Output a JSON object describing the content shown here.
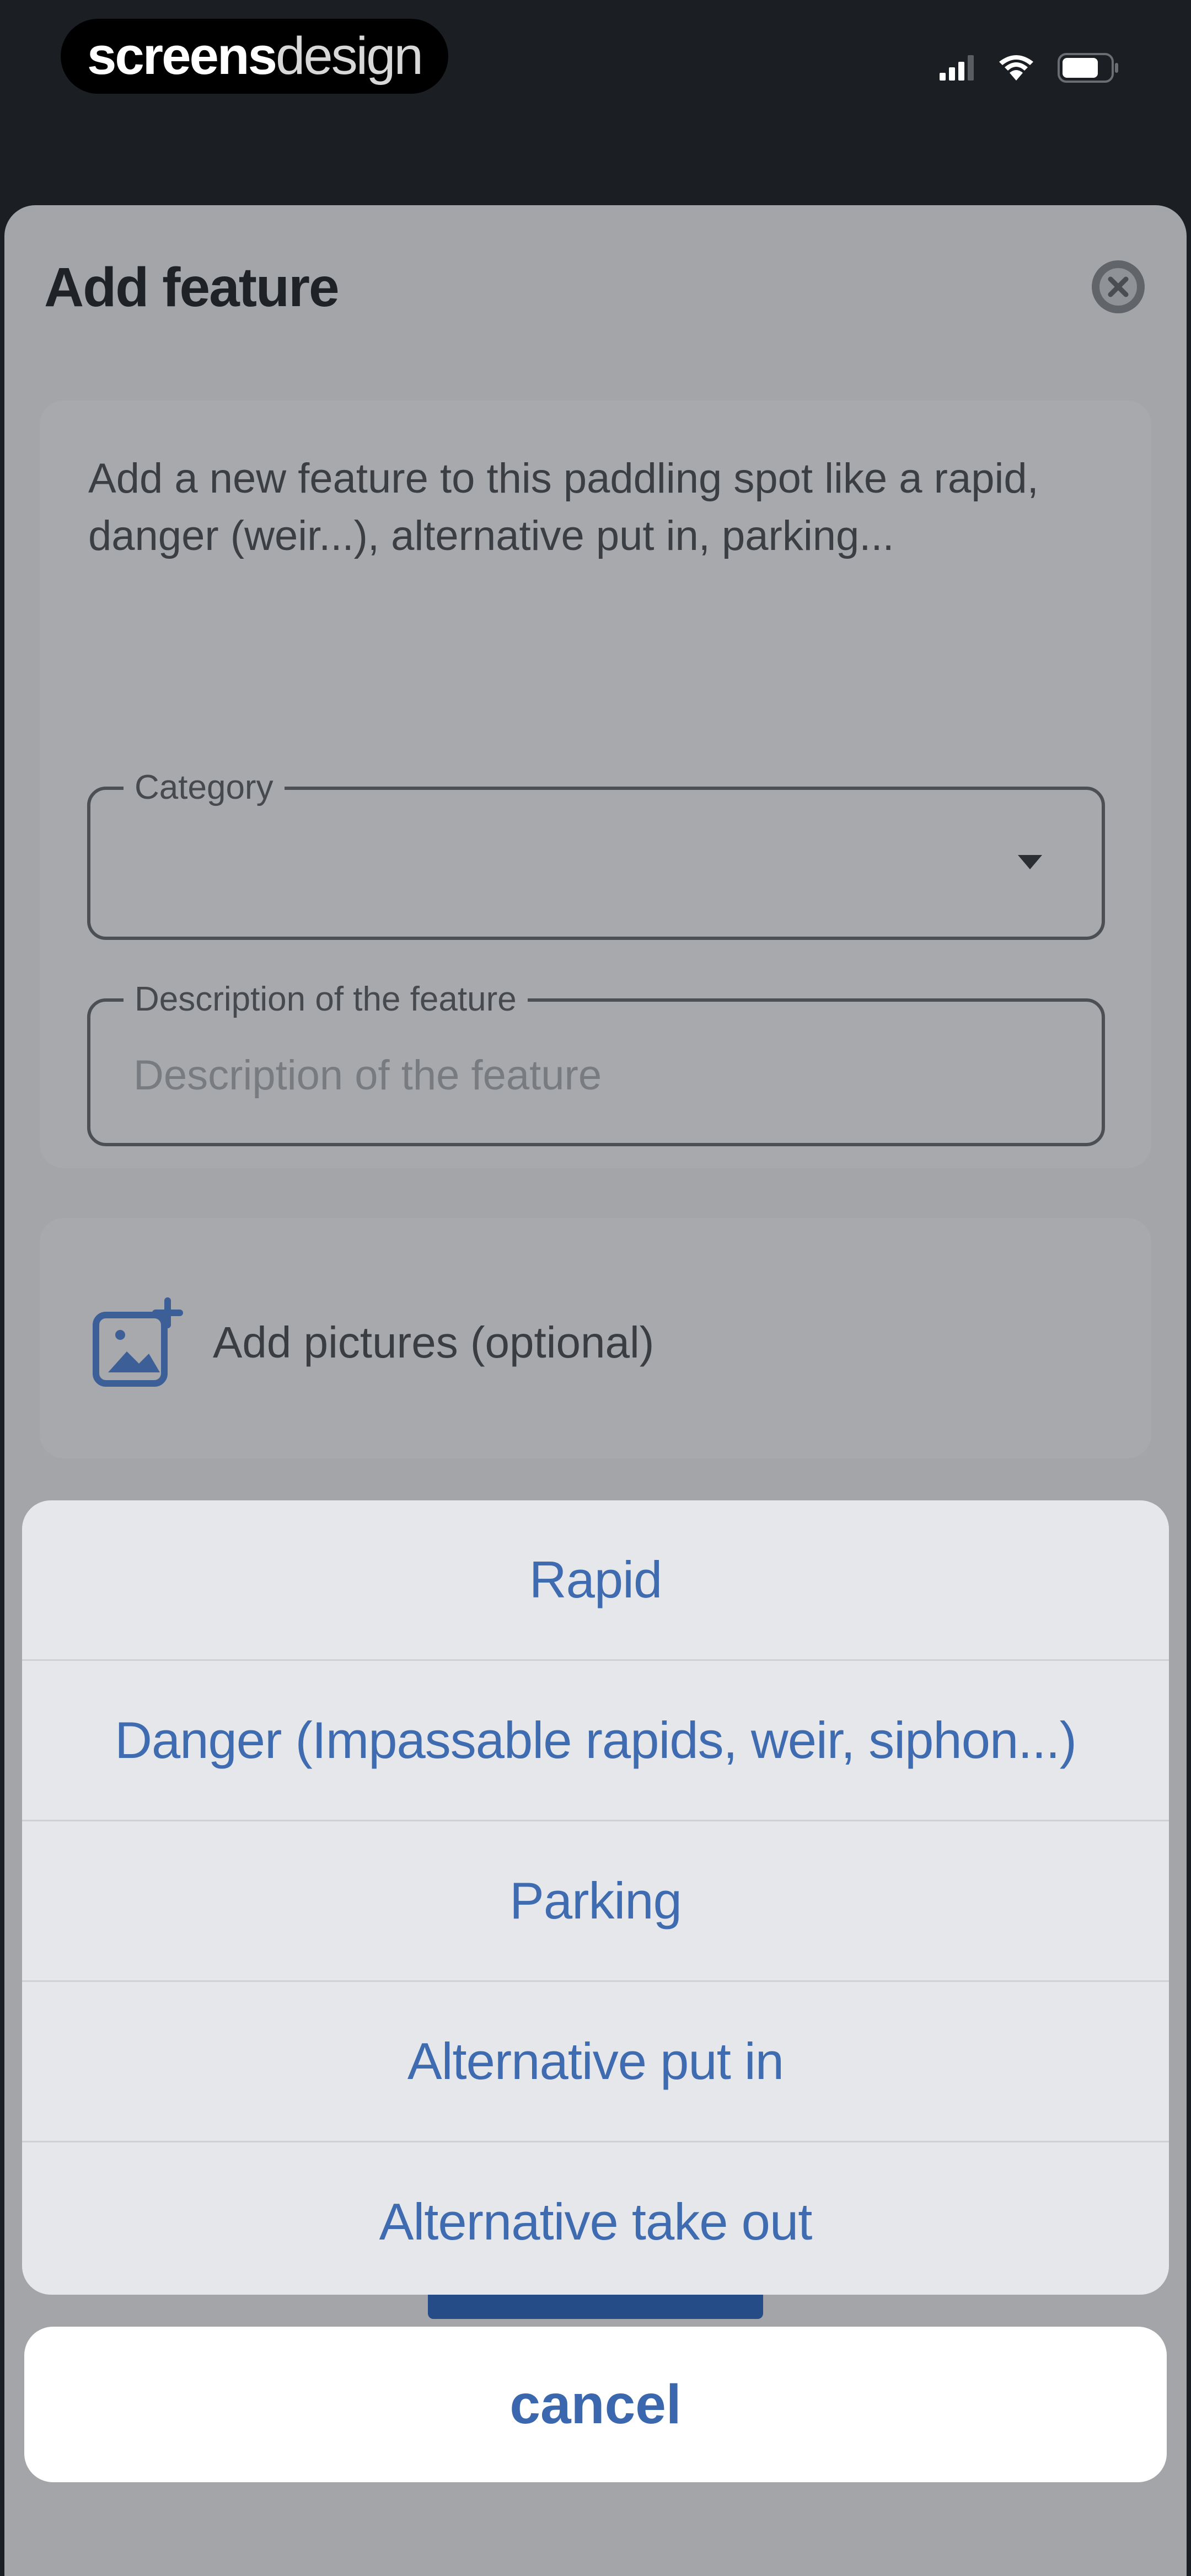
{
  "status_bar": {
    "watermark_bold": "screens",
    "watermark_light": "design",
    "icons": [
      "cellular-signal-icon",
      "wifi-icon",
      "battery-icon"
    ]
  },
  "sheet": {
    "title": "Add feature",
    "close_icon": "close-circle-icon",
    "intro_text": "Add a new feature to this paddling spot like a rapid, danger (weir...), alternative put in, parking...",
    "category": {
      "label": "Category",
      "value": "",
      "arrow_icon": "dropdown-arrow-icon"
    },
    "description": {
      "label": "Description of the feature",
      "placeholder": "Description of the feature"
    },
    "pictures": {
      "icon": "add-photo-icon",
      "label": "Add pictures (optional)"
    }
  },
  "action_sheet": {
    "options": [
      "Rapid",
      "Danger (Impassable rapids, weir, siphon...)",
      "Parking",
      "Alternative put in",
      "Alternative take out"
    ],
    "cancel_label": "cancel"
  },
  "colors": {
    "background": "#1b1e22",
    "sheet_dimmed": "#a3a5a9",
    "action_sheet": "#e6e7ea",
    "accent_blue": "#3f6bb0",
    "primary_button": "#264c88"
  }
}
